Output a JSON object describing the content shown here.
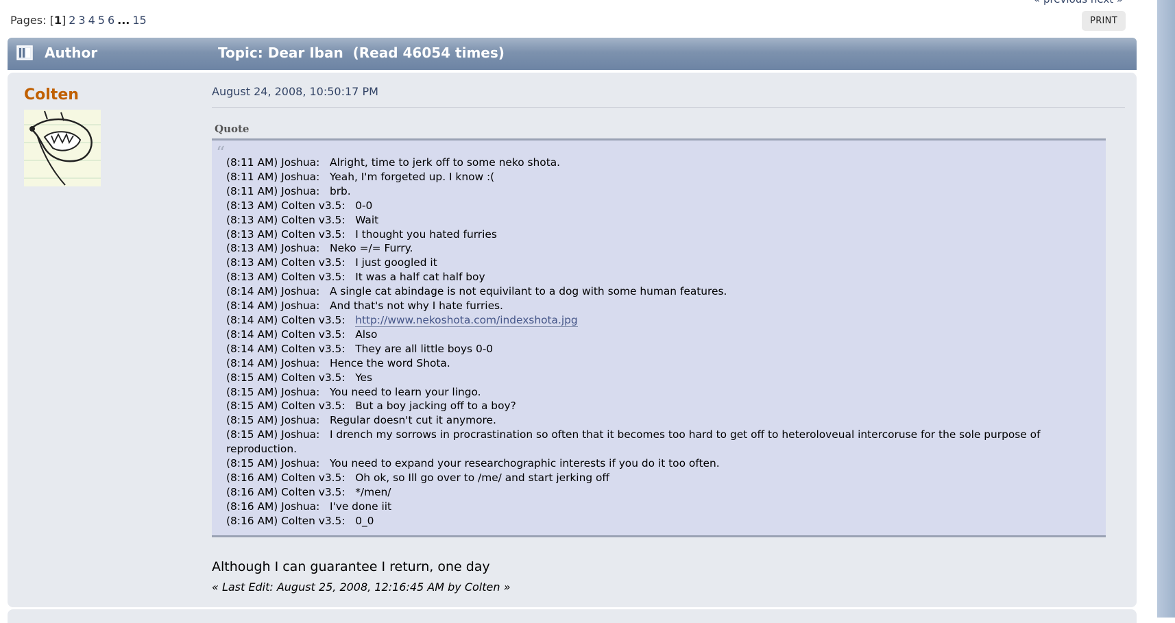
{
  "nav": {
    "prevnext": "« previous next »"
  },
  "pagination": {
    "label": "Pages:",
    "current": "1",
    "pages": [
      "2",
      "3",
      "4",
      "5",
      "6"
    ],
    "ellipsis": "...",
    "last": "15"
  },
  "toolbar": {
    "print_label": "PRINT"
  },
  "header": {
    "author_label": "Author",
    "topic_title": "Topic: Dear Iban  (Read 46054 times)"
  },
  "post": {
    "poster_name": "Colten",
    "date": "August 24, 2008, 10:50:17 PM",
    "quote_header": "Quote",
    "quote_lines": [
      "(8:11 AM) Joshua:   Alright, time to jerk off to some neko shota.",
      "(8:11 AM) Joshua:   Yeah, I'm forgeted up. I know :(",
      "(8:11 AM) Joshua:   brb.",
      "(8:13 AM) Colten v3.5:   0-0",
      "(8:13 AM) Colten v3.5:   Wait",
      "(8:13 AM) Colten v3.5:   I thought you hated furries",
      "(8:13 AM) Joshua:   Neko =/= Furry.",
      "(8:13 AM) Colten v3.5:   I just googled it",
      "(8:13 AM) Colten v3.5:   It was a half cat half boy",
      "(8:14 AM) Joshua:   A single cat abindage is not equivilant to a dog with some human features.",
      "(8:14 AM) Joshua:   And that's not why I hate furries.",
      "(8:14 AM) Colten v3.5:   ",
      "(8:14 AM) Colten v3.5:   Also",
      "(8:14 AM) Colten v3.5:   They are all little boys 0-0",
      "(8:14 AM) Joshua:   Hence the word Shota.",
      "(8:15 AM) Colten v3.5:   Yes",
      "(8:15 AM) Joshua:   You need to learn your lingo.",
      "(8:15 AM) Colten v3.5:   But a boy jacking off to a boy?",
      "(8:15 AM) Joshua:   Regular doesn't cut it anymore.",
      "(8:15 AM) Joshua:   I drench my sorrows in procrastination so often that it becomes too hard to get off to heteroloveual intercoruse for the sole purpose of reproduction.",
      "(8:15 AM) Joshua:   You need to expand your researchographic interests if you do it too often.",
      "(8:16 AM) Colten v3.5:   Oh ok, so Ill go over to /me/ and start jerking off",
      "(8:16 AM) Colten v3.5:   */men/",
      "(8:16 AM) Joshua:   I've done iit",
      "(8:16 AM) Colten v3.5:   0_0"
    ],
    "quote_link": "http://www.nekoshota.com/indexshota.jpg",
    "signature": "Although I can guarantee I return, one day",
    "last_edit": "« Last Edit: August 25, 2008, 12:16:45 AM by Colten »"
  }
}
